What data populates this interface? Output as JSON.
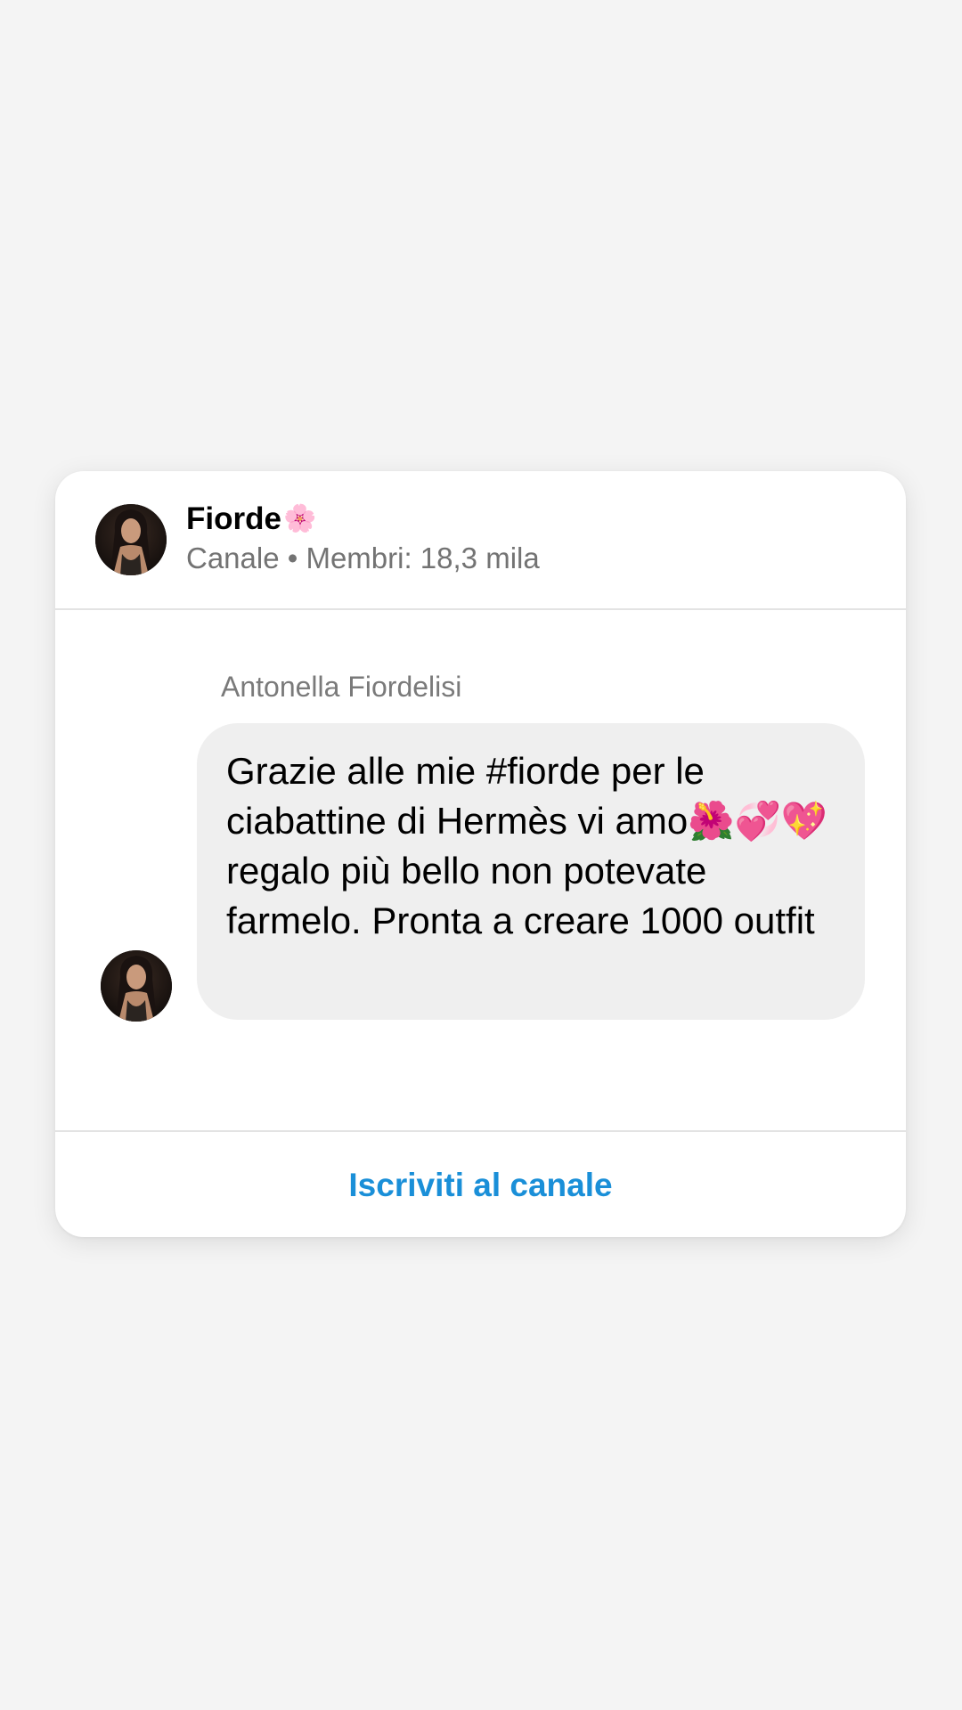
{
  "channel": {
    "name": "Fiorde",
    "name_emoji": "🌸",
    "meta": "Canale • Membri: 18,3 mila"
  },
  "message": {
    "sender": "Antonella Fiordelisi",
    "text": "Grazie alle mie #fiorde per le ciabattine di Hermès vi amo🌺💞💖regalo più bello non potevate farmelo. Pronta a creare 1000 outfit"
  },
  "footer": {
    "subscribe_label": "Iscriviti al canale"
  },
  "colors": {
    "background": "#f4f4f4",
    "card": "#ffffff",
    "bubble": "#efefef",
    "accent": "#1a8fd8",
    "meta_text": "#737373"
  }
}
